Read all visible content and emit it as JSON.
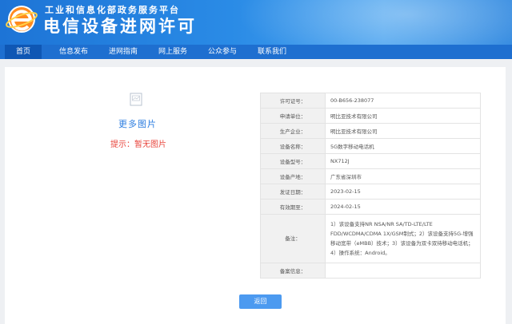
{
  "header": {
    "org_name": "工业和信息化部政务服务平台",
    "site_title": "电信设备进网许可",
    "logo_icon": "e-globe-logo-icon"
  },
  "nav": {
    "items": [
      "首页",
      "信息发布",
      "进网指南",
      "网上服务",
      "公众参与",
      "联系我们"
    ],
    "active": "首页"
  },
  "left_panel": {
    "image_icon": "broken-image-icon",
    "more_images": "更多图片",
    "hint": "提示：暂无图片"
  },
  "info": {
    "rows": [
      {
        "key": "许可证号：",
        "value": "00-B656-238077"
      },
      {
        "key": "申请单位：",
        "value": "明比亚技术有限公司"
      },
      {
        "key": "生产企业：",
        "value": "明比亚技术有限公司"
      },
      {
        "key": "设备名称：",
        "value": "5G数字移动电话机"
      },
      {
        "key": "设备型号：",
        "value": "NX712J"
      },
      {
        "key": "设备产地：",
        "value": "广东省深圳市"
      },
      {
        "key": "发证日期：",
        "value": "2023-02-15"
      },
      {
        "key": "有效期至：",
        "value": "2024-02-15"
      }
    ],
    "remark_key": "备注：",
    "remark_value": "1）该设备支持NR NSA/NR SA/TD-LTE/LTE FDD/WCDMA/CDMA 1X/GSM制式；2）该设备支持5G-增强移动宽带（eMBB）技术；3）该设备为双卡双待移动电话机；4）操作系统：Android。",
    "extra_key": "备案信息：",
    "extra_value": ""
  },
  "back_button": "返回",
  "colors": {
    "nav": "#1e6fd0",
    "accent": "#2c7de0",
    "hint": "#e8453c",
    "button": "#4c9af0"
  }
}
